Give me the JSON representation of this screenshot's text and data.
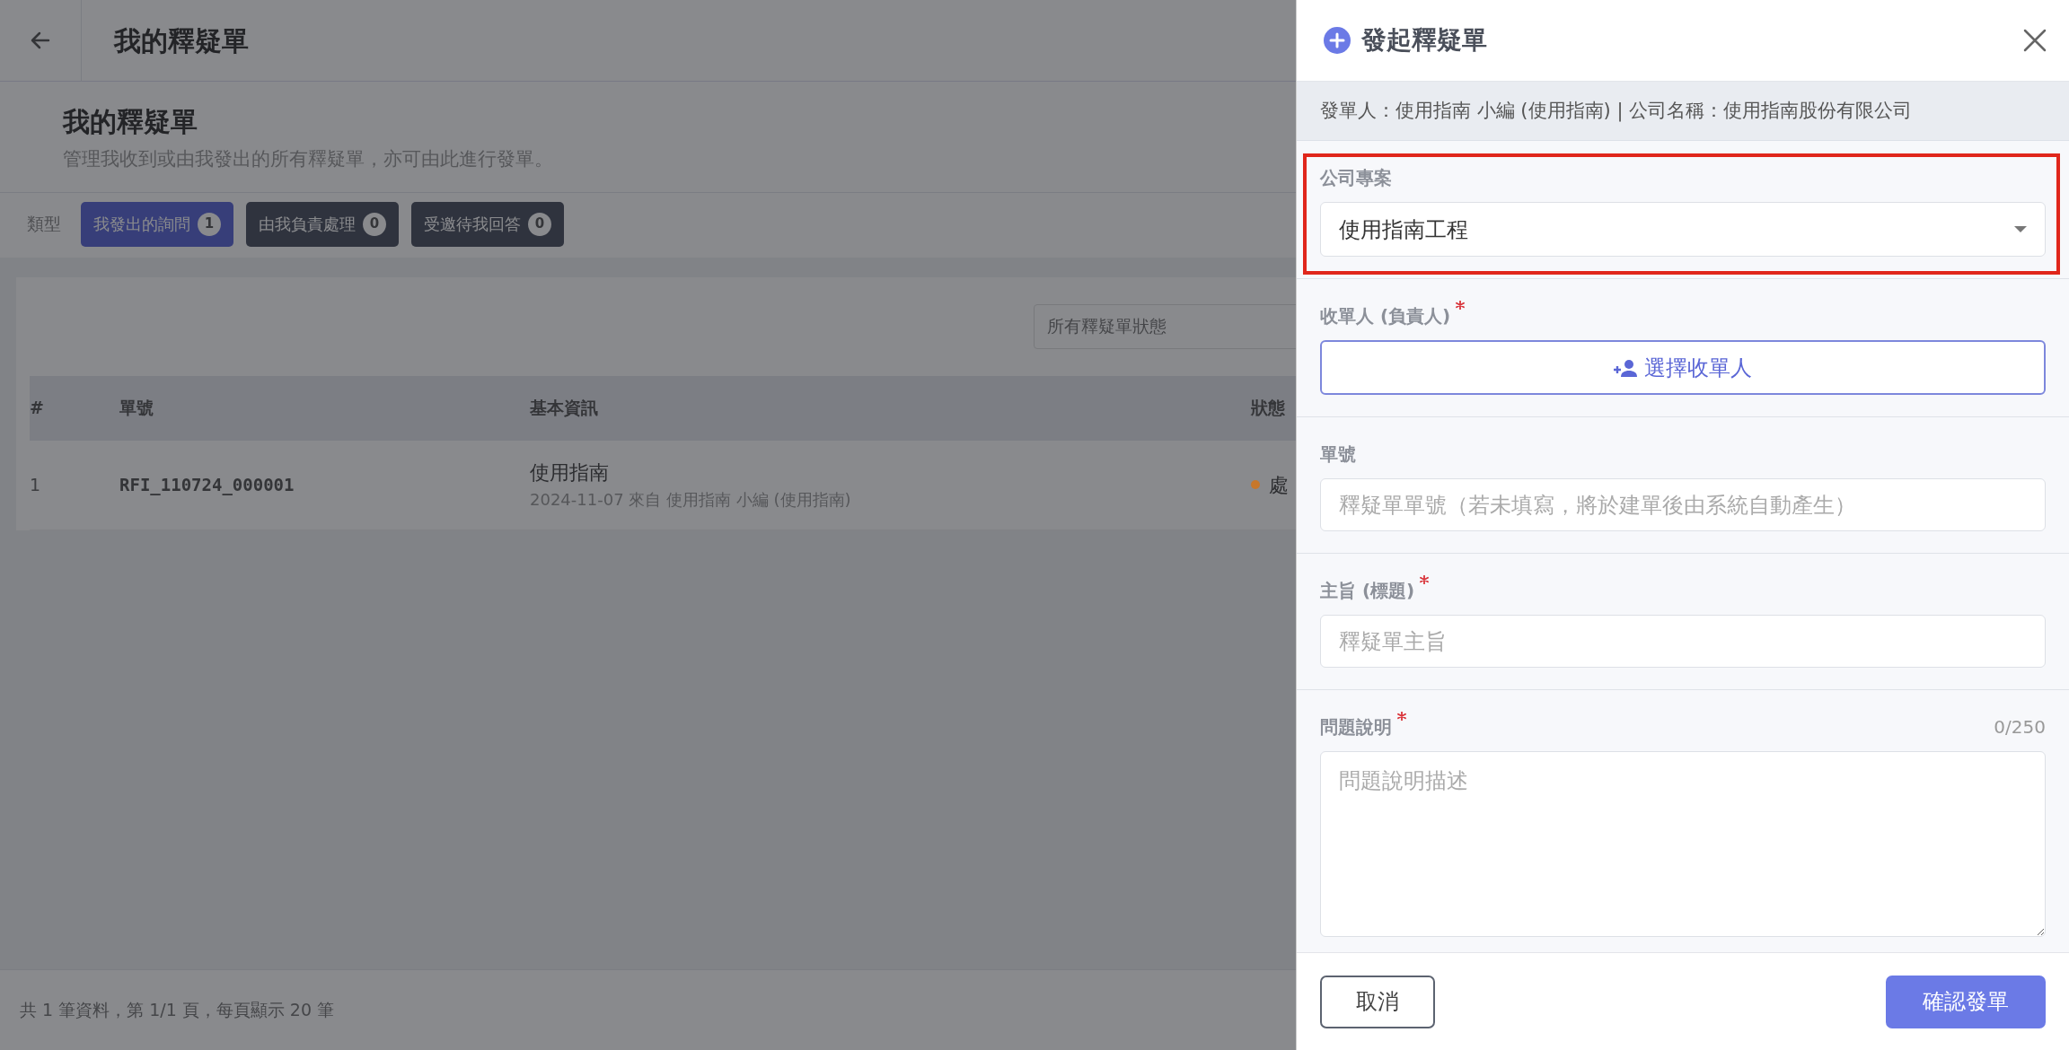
{
  "page": {
    "header_title": "我的釋疑單",
    "title": "我的釋疑單",
    "subtitle": "管理我收到或由我發出的所有釋疑單，亦可由此進行發單。"
  },
  "filter": {
    "label": "類型",
    "chips": [
      {
        "label": "我發出的詢問",
        "count": "1",
        "selected": true
      },
      {
        "label": "由我負責處理",
        "count": "0",
        "selected": false
      },
      {
        "label": "受邀待我回答",
        "count": "0",
        "selected": false
      }
    ]
  },
  "table": {
    "status_filter": "所有釋疑單狀態",
    "columns": [
      "#",
      "單號",
      "基本資訊",
      "狀態"
    ],
    "rows": [
      {
        "index": "1",
        "number": "RFI_110724_000001",
        "title": "使用指南",
        "meta": "2024-11-07 來自 使用指南 小編 (使用指南)",
        "status": "處",
        "color": "#c7772a"
      }
    ]
  },
  "pagination": "共 1 筆資料，第 1/1 頁，每頁顯示 20 筆",
  "drawer": {
    "title": "發起釋疑單",
    "info": "發單人：使用指南 小編 (使用指南) | 公司名稱：使用指南股份有限公司",
    "fields": [
      {
        "kind": "select",
        "label": "公司專案",
        "required": false,
        "highlighted": true,
        "value": "使用指南工程"
      },
      {
        "kind": "picker",
        "label": "收單人 (負責人)",
        "required": true,
        "highlighted": false,
        "button": "選擇收單人"
      },
      {
        "kind": "text",
        "label": "單號",
        "required": false,
        "highlighted": false,
        "placeholder": "釋疑單單號（若未填寫，將於建單後由系統自動產生）"
      },
      {
        "kind": "text",
        "label": "主旨 (標題)",
        "required": true,
        "highlighted": false,
        "placeholder": "釋疑單主旨"
      },
      {
        "kind": "textarea",
        "label": "問題說明",
        "required": true,
        "highlighted": false,
        "counter": "0/250",
        "placeholder": "問題說明描述"
      }
    ],
    "buttons": [
      {
        "kind": "cancel",
        "label": "取消"
      },
      {
        "kind": "confirm",
        "label": "確認發單"
      }
    ]
  }
}
